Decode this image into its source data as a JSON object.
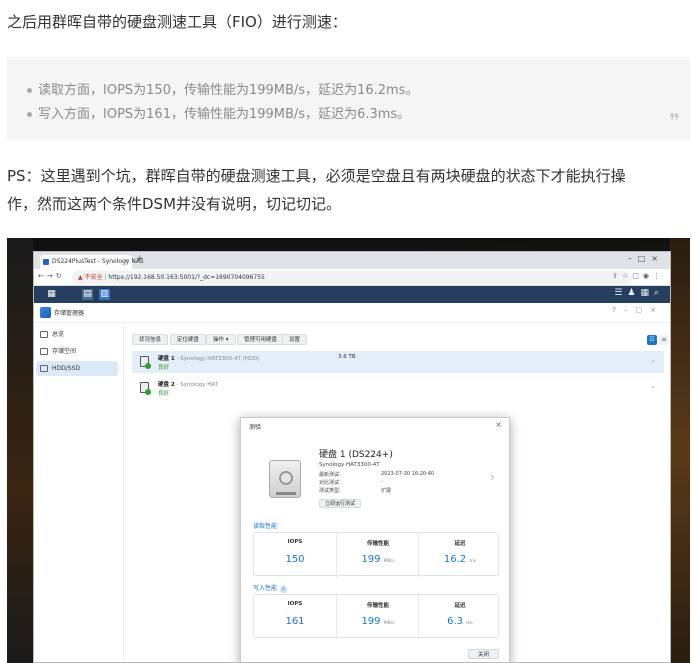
{
  "article": {
    "intro": "之后用群晖自带的硬盘测速工具（FIO）进行测速：",
    "bullets": [
      "读取方面，IOPS为150，传输性能为199MB/s，延迟为16.2ms。",
      "写入方面，IOPS为161，传输性能为199MB/s，延迟为6.3ms。"
    ],
    "ps_line1": "PS：这里遇到个坑，群晖自带的硬盘测速工具，必须是空盘且有两块硬盘的状态下才能执行操",
    "ps_line2": "作，然而这两个条件DSM并没有说明，切记切记。"
  },
  "browser": {
    "tab_title": "DS224PlusTest - Synology NAS",
    "insecure_label": "不安全",
    "url": "https://192.168.50.163:5001/?_dc=1690704096755"
  },
  "app": {
    "title": "存储管理器",
    "sidebar": [
      {
        "label": "总览"
      },
      {
        "label": "存储空间"
      },
      {
        "label": "HDD/SSD"
      }
    ],
    "toolbar": {
      "status": "状况信息",
      "locate": "定位硬盘",
      "action": "操作 ▾",
      "manage": "管理可用硬盘",
      "settings": "设置"
    },
    "drives": [
      {
        "name": "硬盘 1",
        "model": " - Synology HAT3300-4T (HDD)",
        "status": "良好",
        "capacity": "3.6 TB"
      },
      {
        "name": "硬盘 2",
        "model": " - Synology HAT",
        "status": "良好",
        "capacity": ""
      }
    ]
  },
  "dialog": {
    "header": "测验",
    "title": "硬盘 1 (DS224+)",
    "model": "Synology HAT3300-4T",
    "meta": [
      {
        "k": "最新测试:",
        "v": "2023-07-30 16:20:40"
      },
      {
        "k": "对比测试:",
        "v": "-"
      },
      {
        "k": "测试类型:",
        "v": "扩展"
      }
    ],
    "run_button": "立即运行测试",
    "read_label": "读取性能",
    "write_label": "写入性能",
    "col_iops": "IOPS",
    "col_throughput": "传输性能",
    "col_latency": "延迟",
    "unit_throughput": "MB/s",
    "unit_latency": "ms",
    "read": {
      "iops": "150",
      "throughput": "199",
      "latency": "16.2"
    },
    "write": {
      "iops": "161",
      "throughput": "199",
      "latency": "6.3"
    },
    "close_button": "关闭"
  }
}
